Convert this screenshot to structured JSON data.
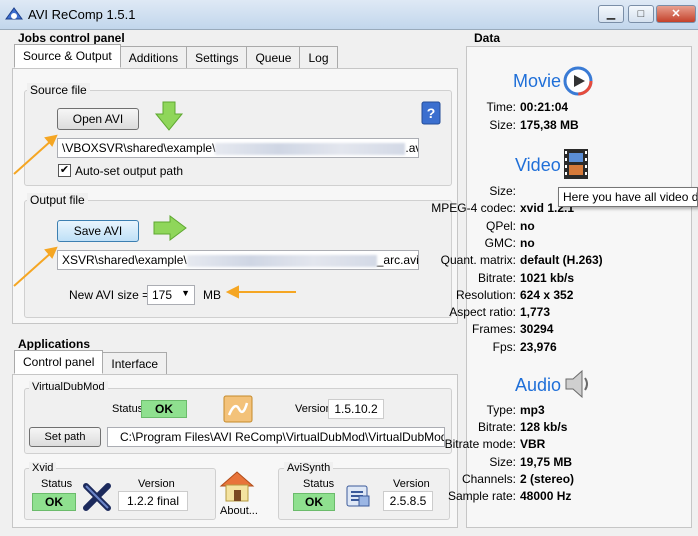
{
  "window": {
    "title": "AVI ReComp  1.5.1",
    "min": "▁",
    "max": "□",
    "close": "✕"
  },
  "jobs": {
    "title": "Jobs control panel",
    "tabs": [
      "Source & Output",
      "Additions",
      "Settings",
      "Queue",
      "Log"
    ],
    "source": {
      "group": "Source file",
      "open_button": "Open AVI",
      "path_prefix": "\\VBOXSVR\\shared\\example\\",
      "path_suffix": ".avi",
      "autoset_label": "Auto-set output path",
      "autoset_checked": true
    },
    "output": {
      "group": "Output file",
      "save_button": "Save AVI",
      "path_prefix": "XSVR\\shared\\example\\",
      "path_suffix": "_arc.avi",
      "size_label": "New AVI size =",
      "size_value": "175",
      "size_unit": "MB"
    }
  },
  "applications": {
    "title": "Applications",
    "tabs": [
      "Control panel",
      "Interface"
    ],
    "virtualdub": {
      "group": "VirtualDubMod",
      "status_label": "Status",
      "status": "OK",
      "version_label": "Version",
      "version": "1.5.10.2",
      "setpath_button": "Set path",
      "path": "C:\\Program Files\\AVI ReComp\\VirtualDubMod\\VirtualDubMod.exe"
    },
    "xvid": {
      "group": "Xvid",
      "status_label": "Status",
      "status": "OK",
      "version_label": "Version",
      "version": "1.2.2 final"
    },
    "about": "About...",
    "avisynth": {
      "group": "AviSynth",
      "status_label": "Status",
      "status": "OK",
      "version_label": "Version",
      "version": "2.5.8.5"
    }
  },
  "data": {
    "title": "Data",
    "movie": {
      "heading": "Movie",
      "rows": [
        {
          "label": "Time:",
          "value": "00:21:04"
        },
        {
          "label": "Size:",
          "value": "175,38 MB"
        }
      ]
    },
    "video": {
      "heading": "Video",
      "tooltip": "Here you have all video da",
      "rows": [
        {
          "label": "Size:",
          "value": ""
        },
        {
          "label": "MPEG-4 codec:",
          "value": "xvid 1.2.1"
        },
        {
          "label": "QPel:",
          "value": "no"
        },
        {
          "label": "GMC:",
          "value": "no"
        },
        {
          "label": "Quant. matrix:",
          "value": "default (H.263)"
        },
        {
          "label": "Bitrate:",
          "value": "1021 kb/s"
        },
        {
          "label": "Resolution:",
          "value": "624 x 352"
        },
        {
          "label": "Aspect ratio:",
          "value": "1,773"
        },
        {
          "label": "Frames:",
          "value": "30294"
        },
        {
          "label": "Fps:",
          "value": "23,976"
        }
      ]
    },
    "audio": {
      "heading": "Audio",
      "rows": [
        {
          "label": "Type:",
          "value": "mp3"
        },
        {
          "label": "Bitrate:",
          "value": "128 kb/s"
        },
        {
          "label": "Bitrate mode:",
          "value": "VBR"
        },
        {
          "label": "Size:",
          "value": "19,75 MB"
        },
        {
          "label": "Channels:",
          "value": "2 (stereo)"
        },
        {
          "label": "Sample rate:",
          "value": "48000 Hz"
        }
      ]
    }
  },
  "colors": {
    "accent_arrow": "#f5a623",
    "ok_green": "#8fe08f",
    "heading_blue": "#1f6fd8"
  },
  "icons": [
    "app-icon",
    "help-icon",
    "green-down-arrow-icon",
    "green-right-arrow-icon",
    "movie-play-icon",
    "film-strip-icon",
    "speaker-icon",
    "virtualdub-icon",
    "xvid-icon",
    "house-icon",
    "avisynth-icon"
  ]
}
